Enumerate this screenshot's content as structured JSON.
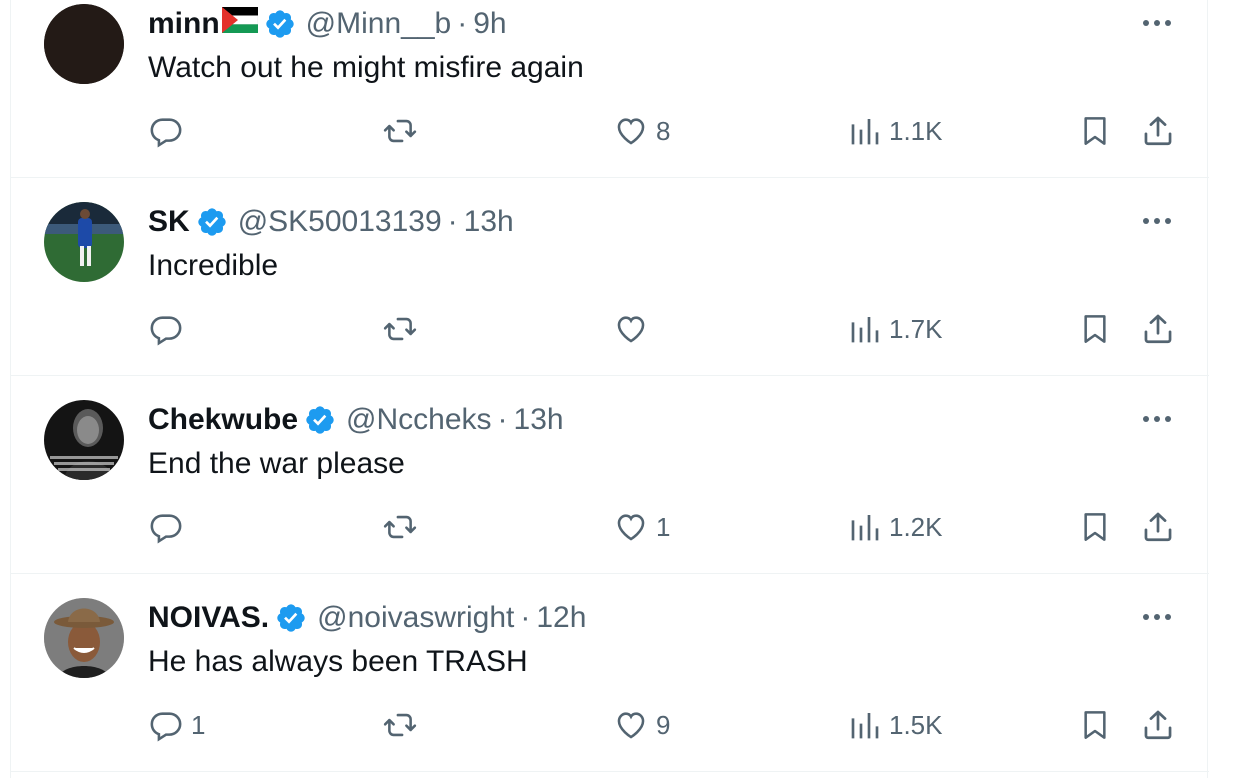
{
  "colors": {
    "text": "#0f1419",
    "muted": "#536471",
    "verified": "#1d9bf0",
    "divider": "#eff3f4"
  },
  "tweets": [
    {
      "name": "minn",
      "has_flag": true,
      "flag": "palestine-flag",
      "verified": true,
      "handle": "@Minn__b",
      "separator": "·",
      "time": "9h",
      "text": "Watch out he might misfire again",
      "replies": "",
      "retweets": "",
      "likes": "8",
      "views": "1.1K",
      "avatar": "dark-avatar"
    },
    {
      "name": "SK",
      "has_flag": false,
      "verified": true,
      "handle": "@SK50013139",
      "separator": "·",
      "time": "13h",
      "text": "Incredible",
      "replies": "",
      "retweets": "",
      "likes": "",
      "views": "1.7K",
      "avatar": "football-player-avatar"
    },
    {
      "name": "Chekwube",
      "has_flag": false,
      "verified": true,
      "handle": "@Nccheks",
      "separator": "·",
      "time": "13h",
      "text": "End the war please",
      "replies": "",
      "retweets": "",
      "likes": "1",
      "views": "1.2K",
      "avatar": "portrait-quote-avatar"
    },
    {
      "name": "NOIVAS.",
      "has_flag": false,
      "verified": true,
      "handle": "@noivaswright",
      "separator": "·",
      "time": "12h",
      "text": "He has always been TRASH",
      "replies": "1",
      "retweets": "",
      "likes": "9",
      "views": "1.5K",
      "avatar": "cowboy-hat-avatar"
    }
  ]
}
